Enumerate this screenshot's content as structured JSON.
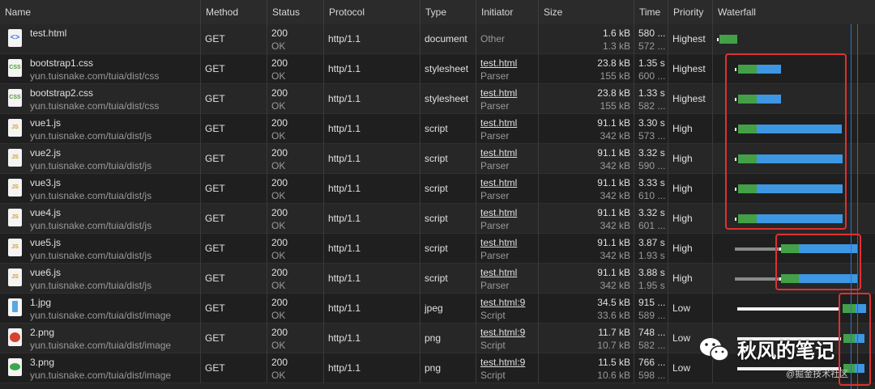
{
  "columns": [
    "Name",
    "Method",
    "Status",
    "Protocol",
    "Type",
    "Initiator",
    "Size",
    "Time",
    "Priority",
    "Waterfall"
  ],
  "rows": [
    {
      "icon": "html-file-icon",
      "name": "test.html",
      "path": "",
      "method": "GET",
      "status": "200",
      "status_text": "OK",
      "protocol": "http/1.1",
      "type": "document",
      "initiator": "Other",
      "initiator_sub": "",
      "size": "1.6 kB",
      "size_sub": "1.3 kB",
      "time": "580 ...",
      "time_sub": "572 ...",
      "priority": "Highest"
    },
    {
      "icon": "css-file-icon",
      "name": "bootstrap1.css",
      "path": "yun.tuisnake.com/tuia/dist/css",
      "method": "GET",
      "status": "200",
      "status_text": "OK",
      "protocol": "http/1.1",
      "type": "stylesheet",
      "initiator": "test.html",
      "initiator_sub": "Parser",
      "size": "23.8 kB",
      "size_sub": "155 kB",
      "time": "1.35 s",
      "time_sub": "600 ...",
      "priority": "Highest"
    },
    {
      "icon": "css-file-icon",
      "name": "bootstrap2.css",
      "path": "yun.tuisnake.com/tuia/dist/css",
      "method": "GET",
      "status": "200",
      "status_text": "OK",
      "protocol": "http/1.1",
      "type": "stylesheet",
      "initiator": "test.html",
      "initiator_sub": "Parser",
      "size": "23.8 kB",
      "size_sub": "155 kB",
      "time": "1.33 s",
      "time_sub": "582 ...",
      "priority": "Highest"
    },
    {
      "icon": "js-file-icon",
      "name": "vue1.js",
      "path": "yun.tuisnake.com/tuia/dist/js",
      "method": "GET",
      "status": "200",
      "status_text": "OK",
      "protocol": "http/1.1",
      "type": "script",
      "initiator": "test.html",
      "initiator_sub": "Parser",
      "size": "91.1 kB",
      "size_sub": "342 kB",
      "time": "3.30 s",
      "time_sub": "573 ...",
      "priority": "High"
    },
    {
      "icon": "js-file-icon",
      "name": "vue2.js",
      "path": "yun.tuisnake.com/tuia/dist/js",
      "method": "GET",
      "status": "200",
      "status_text": "OK",
      "protocol": "http/1.1",
      "type": "script",
      "initiator": "test.html",
      "initiator_sub": "Parser",
      "size": "91.1 kB",
      "size_sub": "342 kB",
      "time": "3.32 s",
      "time_sub": "590 ...",
      "priority": "High"
    },
    {
      "icon": "js-file-icon",
      "name": "vue3.js",
      "path": "yun.tuisnake.com/tuia/dist/js",
      "method": "GET",
      "status": "200",
      "status_text": "OK",
      "protocol": "http/1.1",
      "type": "script",
      "initiator": "test.html",
      "initiator_sub": "Parser",
      "size": "91.1 kB",
      "size_sub": "342 kB",
      "time": "3.33 s",
      "time_sub": "610 ...",
      "priority": "High"
    },
    {
      "icon": "js-file-icon",
      "name": "vue4.js",
      "path": "yun.tuisnake.com/tuia/dist/js",
      "method": "GET",
      "status": "200",
      "status_text": "OK",
      "protocol": "http/1.1",
      "type": "script",
      "initiator": "test.html",
      "initiator_sub": "Parser",
      "size": "91.1 kB",
      "size_sub": "342 kB",
      "time": "3.32 s",
      "time_sub": "601 ...",
      "priority": "High"
    },
    {
      "icon": "js-file-icon",
      "name": "vue5.js",
      "path": "yun.tuisnake.com/tuia/dist/js",
      "method": "GET",
      "status": "200",
      "status_text": "OK",
      "protocol": "http/1.1",
      "type": "script",
      "initiator": "test.html",
      "initiator_sub": "Parser",
      "size": "91.1 kB",
      "size_sub": "342 kB",
      "time": "3.87 s",
      "time_sub": "1.93 s",
      "priority": "High"
    },
    {
      "icon": "js-file-icon",
      "name": "vue6.js",
      "path": "yun.tuisnake.com/tuia/dist/js",
      "method": "GET",
      "status": "200",
      "status_text": "OK",
      "protocol": "http/1.1",
      "type": "script",
      "initiator": "test.html",
      "initiator_sub": "Parser",
      "size": "91.1 kB",
      "size_sub": "342 kB",
      "time": "3.88 s",
      "time_sub": "1.95 s",
      "priority": "High"
    },
    {
      "icon": "jpg-image-icon",
      "name": "1.jpg",
      "path": "yun.tuisnake.com/tuia/dist/image",
      "method": "GET",
      "status": "200",
      "status_text": "OK",
      "protocol": "http/1.1",
      "type": "jpeg",
      "initiator": "test.html:9",
      "initiator_sub": "Script",
      "size": "34.5 kB",
      "size_sub": "33.6 kB",
      "time": "915 ...",
      "time_sub": "589 ...",
      "priority": "Low"
    },
    {
      "icon": "png-image-icon",
      "name": "2.png",
      "path": "yun.tuisnake.com/tuia/dist/image",
      "method": "GET",
      "status": "200",
      "status_text": "OK",
      "protocol": "http/1.1",
      "type": "png",
      "initiator": "test.html:9",
      "initiator_sub": "Script",
      "size": "11.7 kB",
      "size_sub": "10.7 kB",
      "time": "748 ...",
      "time_sub": "582 ...",
      "priority": "Low"
    },
    {
      "icon": "png-image-icon",
      "name": "3.png",
      "path": "yun.tuisnake.com/tuia/dist/image",
      "method": "GET",
      "status": "200",
      "status_text": "OK",
      "protocol": "http/1.1",
      "type": "png",
      "initiator": "test.html:9",
      "initiator_sub": "Script",
      "size": "11.5 kB",
      "size_sub": "10.6 kB",
      "time": "766 ...",
      "time_sub": "598 ...",
      "priority": "Low"
    }
  ],
  "watermark": {
    "title": "秋风的笔记",
    "subtitle": "@掘金技术社区"
  },
  "colors": {
    "background": "#242424",
    "bar_green": "#43a047",
    "bar_blue": "#3d97e3",
    "highlight_box": "#e03030"
  }
}
